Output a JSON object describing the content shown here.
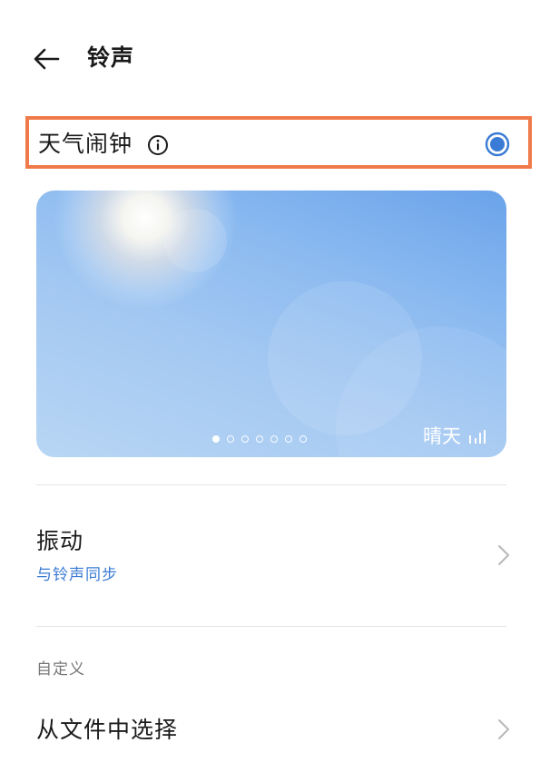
{
  "header": {
    "title": "铃声",
    "back_icon": "arrow-left-icon"
  },
  "ringtone_option": {
    "label": "天气闹钟",
    "info_icon": "info-circle-icon",
    "selected": true,
    "highlight_color": "#f07a49",
    "radio_color": "#3a7bd5"
  },
  "preview_card": {
    "weather_label": "晴天",
    "signal_icon": "signal-bars-icon",
    "page_count": 7,
    "active_page": 1
  },
  "vibration": {
    "title": "振动",
    "subtitle": "与铃声同步",
    "chevron_icon": "chevron-right-icon"
  },
  "custom_section": {
    "label": "自定义",
    "choose_from_file": "从文件中选择",
    "chevron_icon": "chevron-right-icon"
  }
}
